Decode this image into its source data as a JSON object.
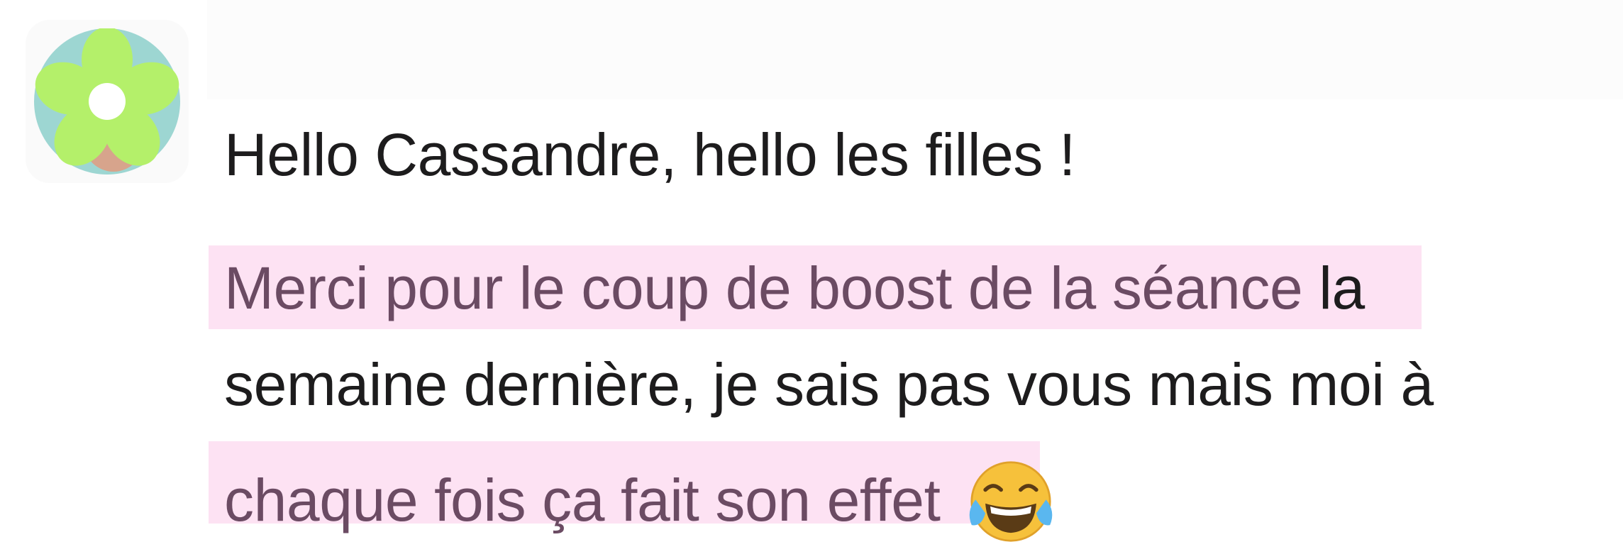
{
  "message": {
    "line1": "Hello Cassandre, hello les filles !",
    "highlight1": "Merci pour le coup de boost de la séance",
    "line2_rest": " la",
    "line3": "semaine dernière, je sais pas vous mais moi à",
    "highlight2": "chaque fois ça fait son effet",
    "emoji_name": "face-with-tears-of-joy"
  },
  "colors": {
    "highlight_bg": "#fde2f3",
    "highlight_text": "#6b4b63",
    "text": "#1d1c1d",
    "avatar_ring": "#9dd6d2",
    "avatar_flower": "#b4f06a"
  },
  "icons": {
    "avatar": "flower-avatar-icon",
    "emoji": "face-with-tears-of-joy-icon"
  }
}
